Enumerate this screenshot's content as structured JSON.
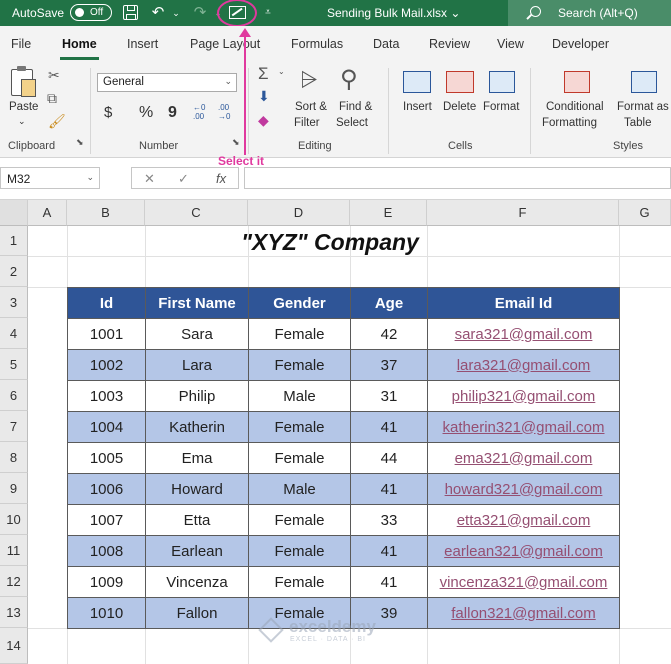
{
  "title_bar": {
    "autosave_label": "AutoSave",
    "autosave_state": "Off",
    "filename": "Sending Bulk Mail.xlsx",
    "filename_caret": "⌄",
    "search_label": "Search (Alt+Q)",
    "colors": {
      "background": "#217346",
      "search_bg": "#4a8d69"
    }
  },
  "annotation": {
    "text": "Select it",
    "color": "#e0399e"
  },
  "tabs": [
    "File",
    "Home",
    "Insert",
    "Page Layout",
    "Formulas",
    "Data",
    "Review",
    "View",
    "Developer"
  ],
  "active_tab": "Home",
  "ribbon": {
    "clipboard": {
      "label": "Clipboard",
      "paste": "Paste"
    },
    "number": {
      "label": "Number",
      "format_value": "General",
      "dollar": "$",
      "percent": "%",
      "comma": "9",
      "inc_decimal": "←0 .00",
      "dec_decimal": ".00 →0"
    },
    "editing": {
      "label": "Editing",
      "sort_filter_1": "Sort &",
      "sort_filter_2": "Filter",
      "find_select_1": "Find &",
      "find_select_2": "Select"
    },
    "cells": {
      "label": "Cells",
      "insert": "Insert",
      "delete": "Delete",
      "format": "Format"
    },
    "styles": {
      "label": "Styles",
      "cond_1": "Conditional",
      "cond_2": "Formatting",
      "table_1": "Format as",
      "table_2": "Table"
    }
  },
  "formula_bar": {
    "name_box": "M32",
    "cancel_symbol": "✕",
    "enter_symbol": "✓",
    "fx_symbol": "fx",
    "formula_value": ""
  },
  "sheet": {
    "columns": [
      "A",
      "B",
      "C",
      "D",
      "E",
      "F",
      "G"
    ],
    "rows": [
      "1",
      "2",
      "3",
      "4",
      "5",
      "6",
      "7",
      "8",
      "9",
      "10",
      "11",
      "12",
      "13",
      "14"
    ],
    "title": "\"XYZ\" Company",
    "table": {
      "headers": [
        "Id",
        "First Name",
        "Gender",
        "Age",
        "Email Id"
      ],
      "rows": [
        [
          "1001",
          "Sara",
          "Female",
          "42",
          "sara321@gmail.com"
        ],
        [
          "1002",
          "Lara",
          "Female",
          "37",
          "lara321@gmail.com"
        ],
        [
          "1003",
          "Philip",
          "Male",
          "31",
          "philip321@gmail.com"
        ],
        [
          "1004",
          "Katherin",
          "Female",
          "41",
          "katherin321@gmail.com"
        ],
        [
          "1005",
          "Ema",
          "Female",
          "44",
          "ema321@gmail.com"
        ],
        [
          "1006",
          "Howard",
          "Male",
          "41",
          "howard321@gmail.com"
        ],
        [
          "1007",
          "Etta",
          "Female",
          "33",
          "etta321@gmail.com"
        ],
        [
          "1008",
          "Earlean",
          "Female",
          "41",
          "earlean321@gmail.com"
        ],
        [
          "1009",
          "Vincenza",
          "Female",
          "41",
          "vincenza321@gmail.com"
        ],
        [
          "1010",
          "Fallon",
          "Female",
          "39",
          "fallon321@gmail.com"
        ]
      ],
      "colors": {
        "header_bg": "#2f5597",
        "alt_row_bg": "#b4c6e7",
        "link": "#954f72"
      }
    }
  },
  "watermark": {
    "name": "exceldemy",
    "tagline": "EXCEL · DATA · BI"
  }
}
